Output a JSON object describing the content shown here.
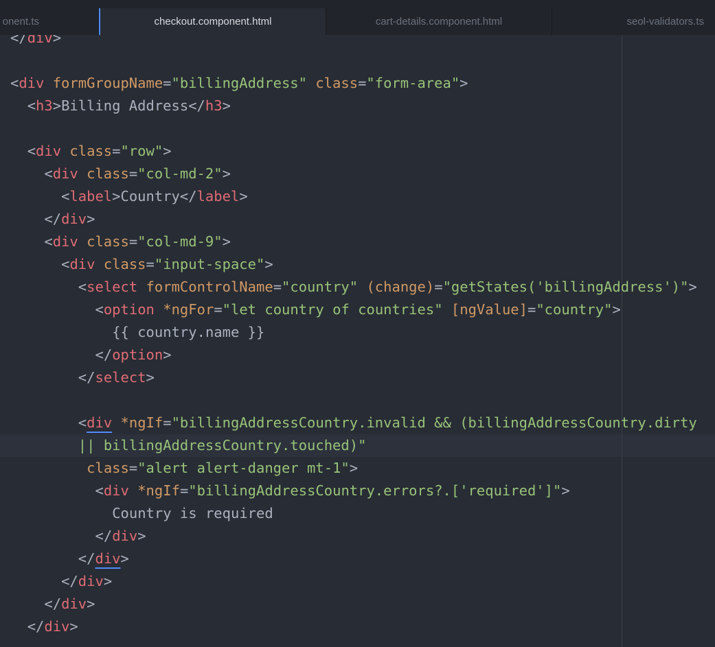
{
  "tabs": [
    {
      "label": "onent.ts",
      "active": false
    },
    {
      "label": "checkout.component.html",
      "active": true
    },
    {
      "label": "cart-details.component.html",
      "active": false
    },
    {
      "label": "seol-validators.ts",
      "active": false
    }
  ],
  "colors": {
    "background": "#282c34",
    "tag": "#e06c75",
    "attribute": "#d19a66",
    "string": "#98c379",
    "punctuation": "#abb2bf",
    "active_tab_accent": "#528bff"
  },
  "code_lines": [
    {
      "indent": 0,
      "tokens": [
        [
          "p",
          "</"
        ],
        [
          "t",
          "div"
        ],
        [
          "p",
          ">"
        ]
      ]
    },
    {
      "indent": 0,
      "tokens": []
    },
    {
      "indent": 0,
      "tokens": [
        [
          "p",
          "<"
        ],
        [
          "t",
          "div"
        ],
        [
          "p",
          " "
        ],
        [
          "a",
          "formGroupName"
        ],
        [
          "p",
          "="
        ],
        [
          "s",
          "\"billingAddress\""
        ],
        [
          "p",
          " "
        ],
        [
          "a",
          "class"
        ],
        [
          "p",
          "="
        ],
        [
          "s",
          "\"form-area\""
        ],
        [
          "p",
          ">"
        ]
      ]
    },
    {
      "indent": 2,
      "tokens": [
        [
          "p",
          "<"
        ],
        [
          "t",
          "h3"
        ],
        [
          "p",
          ">"
        ],
        [
          "x",
          "Billing Address"
        ],
        [
          "p",
          "</"
        ],
        [
          "t",
          "h3"
        ],
        [
          "p",
          ">"
        ]
      ]
    },
    {
      "indent": 0,
      "tokens": []
    },
    {
      "indent": 2,
      "tokens": [
        [
          "p",
          "<"
        ],
        [
          "t",
          "div"
        ],
        [
          "p",
          " "
        ],
        [
          "a",
          "class"
        ],
        [
          "p",
          "="
        ],
        [
          "s",
          "\"row\""
        ],
        [
          "p",
          ">"
        ]
      ]
    },
    {
      "indent": 4,
      "tokens": [
        [
          "p",
          "<"
        ],
        [
          "t",
          "div"
        ],
        [
          "p",
          " "
        ],
        [
          "a",
          "class"
        ],
        [
          "p",
          "="
        ],
        [
          "s",
          "\"col-md-2\""
        ],
        [
          "p",
          ">"
        ]
      ]
    },
    {
      "indent": 6,
      "tokens": [
        [
          "p",
          "<"
        ],
        [
          "t",
          "label"
        ],
        [
          "p",
          ">"
        ],
        [
          "x",
          "Country"
        ],
        [
          "p",
          "</"
        ],
        [
          "t",
          "label"
        ],
        [
          "p",
          ">"
        ]
      ]
    },
    {
      "indent": 4,
      "tokens": [
        [
          "p",
          "</"
        ],
        [
          "t",
          "div"
        ],
        [
          "p",
          ">"
        ]
      ]
    },
    {
      "indent": 4,
      "tokens": [
        [
          "p",
          "<"
        ],
        [
          "t",
          "div"
        ],
        [
          "p",
          " "
        ],
        [
          "a",
          "class"
        ],
        [
          "p",
          "="
        ],
        [
          "s",
          "\"col-md-9\""
        ],
        [
          "p",
          ">"
        ]
      ]
    },
    {
      "indent": 6,
      "tokens": [
        [
          "p",
          "<"
        ],
        [
          "t",
          "div"
        ],
        [
          "p",
          " "
        ],
        [
          "a",
          "class"
        ],
        [
          "p",
          "="
        ],
        [
          "s",
          "\"input-space\""
        ],
        [
          "p",
          ">"
        ]
      ]
    },
    {
      "indent": 8,
      "tokens": [
        [
          "p",
          "<"
        ],
        [
          "t",
          "select"
        ],
        [
          "p",
          " "
        ],
        [
          "a",
          "formControlName"
        ],
        [
          "p",
          "="
        ],
        [
          "s",
          "\"country\""
        ],
        [
          "p",
          " "
        ],
        [
          "a",
          "(change)"
        ],
        [
          "p",
          "="
        ],
        [
          "s",
          "\"getStates('billingAddress')\""
        ],
        [
          "p",
          ">"
        ]
      ]
    },
    {
      "indent": 10,
      "tokens": [
        [
          "p",
          "<"
        ],
        [
          "t",
          "option"
        ],
        [
          "p",
          " "
        ],
        [
          "a",
          "*ngFor"
        ],
        [
          "p",
          "="
        ],
        [
          "s",
          "\"let country of countries\""
        ],
        [
          "p",
          " "
        ],
        [
          "a",
          "[ngValue]"
        ],
        [
          "p",
          "="
        ],
        [
          "s",
          "\"country\""
        ],
        [
          "p",
          ">"
        ]
      ]
    },
    {
      "indent": 12,
      "tokens": [
        [
          "x",
          "{{ country.name }}"
        ]
      ]
    },
    {
      "indent": 10,
      "tokens": [
        [
          "p",
          "</"
        ],
        [
          "t",
          "option"
        ],
        [
          "p",
          ">"
        ]
      ]
    },
    {
      "indent": 8,
      "tokens": [
        [
          "p",
          "</"
        ],
        [
          "t",
          "select"
        ],
        [
          "p",
          ">"
        ]
      ]
    },
    {
      "indent": 0,
      "tokens": []
    },
    {
      "indent": 8,
      "tokens": [
        [
          "p",
          "<"
        ],
        [
          "tu",
          "div"
        ],
        [
          "p",
          " "
        ],
        [
          "a",
          "*ngIf"
        ],
        [
          "p",
          "="
        ],
        [
          "s",
          "\"billingAddressCountry.invalid && (billingAddressCountry.dirty"
        ]
      ]
    },
    {
      "indent": 8,
      "tokens": [
        [
          "s",
          "|| billingAddressCountry.touched)\""
        ]
      ]
    },
    {
      "indent": 9,
      "tokens": [
        [
          "a",
          "class"
        ],
        [
          "p",
          "="
        ],
        [
          "s",
          "\"alert alert-danger mt-1\""
        ],
        [
          "p",
          ">"
        ]
      ]
    },
    {
      "indent": 10,
      "tokens": [
        [
          "p",
          "<"
        ],
        [
          "t",
          "div"
        ],
        [
          "p",
          " "
        ],
        [
          "a",
          "*ngIf"
        ],
        [
          "p",
          "="
        ],
        [
          "s",
          "\"billingAddressCountry.errors?.['required']\""
        ],
        [
          "p",
          ">"
        ]
      ]
    },
    {
      "indent": 12,
      "tokens": [
        [
          "x",
          "Country is required"
        ]
      ]
    },
    {
      "indent": 10,
      "tokens": [
        [
          "p",
          "</"
        ],
        [
          "t",
          "div"
        ],
        [
          "p",
          ">"
        ]
      ]
    },
    {
      "indent": 8,
      "tokens": [
        [
          "p",
          "</"
        ],
        [
          "tu",
          "div"
        ],
        [
          "p",
          ">"
        ]
      ]
    },
    {
      "indent": 6,
      "tokens": [
        [
          "p",
          "</"
        ],
        [
          "t",
          "div"
        ],
        [
          "p",
          ">"
        ]
      ]
    },
    {
      "indent": 4,
      "tokens": [
        [
          "p",
          "</"
        ],
        [
          "t",
          "div"
        ],
        [
          "p",
          ">"
        ]
      ]
    },
    {
      "indent": 2,
      "tokens": [
        [
          "p",
          "</"
        ],
        [
          "t",
          "div"
        ],
        [
          "p",
          ">"
        ]
      ]
    }
  ]
}
